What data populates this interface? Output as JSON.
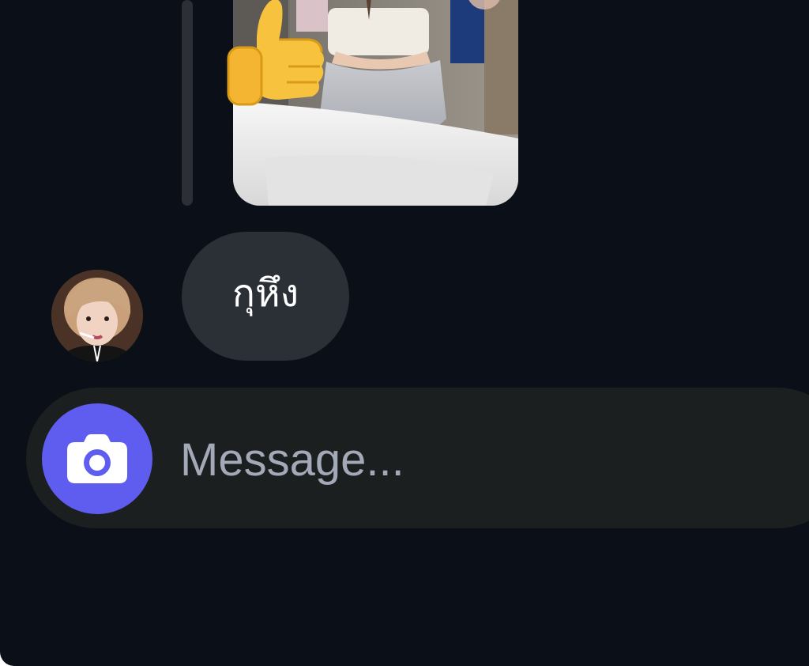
{
  "thread": {
    "messages": [
      {
        "type": "photo",
        "reaction_icon": "thumbs-up-icon",
        "image_description_icon": "mirror-selfie-photo"
      },
      {
        "type": "text",
        "text": "กุหึง",
        "sender_avatar": "avatar"
      }
    ]
  },
  "composer": {
    "placeholder": "Message...",
    "value": "",
    "camera_icon": "camera-icon"
  },
  "colors": {
    "background": "#0b0f17",
    "bubble": "#2b2f36",
    "composer": "#1b1f20",
    "camera_accent": "#5e5df0",
    "placeholder": "#a3a9b7"
  }
}
